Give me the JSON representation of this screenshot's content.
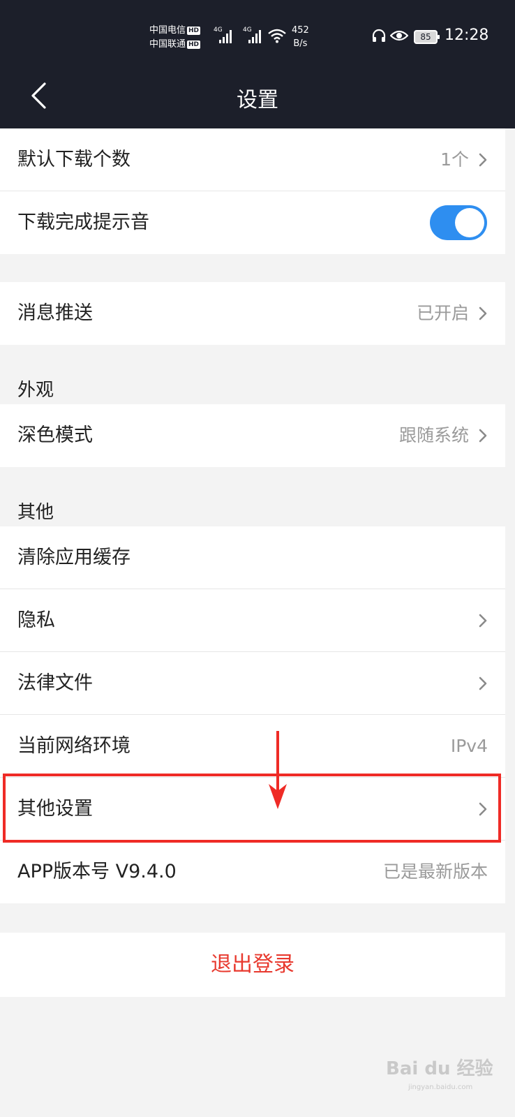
{
  "status_bar": {
    "carrier1": "中国电信",
    "carrier2": "中国联通",
    "hd": "HD",
    "net1": "4G",
    "net2": "4G",
    "speed_value": "452",
    "speed_unit": "B/s",
    "battery": "85",
    "time": "12:28"
  },
  "nav": {
    "title": "设置",
    "back_icon": "chevron-left-icon"
  },
  "download_group": {
    "count_label": "默认下载个数",
    "count_value": "1个",
    "sound_label": "下载完成提示音",
    "sound_enabled": true,
    "toggle_color": "#2e8ef0"
  },
  "push_group": {
    "label": "消息推送",
    "value": "已开启"
  },
  "appearance": {
    "header": "外观",
    "dark_label": "深色模式",
    "dark_value": "跟随系统"
  },
  "other": {
    "header": "其他",
    "clear_cache": "清除应用缓存",
    "privacy": "隐私",
    "legal": "法律文件",
    "network_label": "当前网络环境",
    "network_value": "IPv4",
    "more_settings": "其他设置",
    "version_label": "APP版本号 V9.4.0",
    "version_value": "已是最新版本"
  },
  "logout": {
    "label": "退出登录",
    "color": "#e8392e"
  },
  "annotation": {
    "highlight_color": "#ef2b26"
  },
  "watermark": {
    "brand": "Bai du 经验",
    "url": "jingyan.baidu.com"
  }
}
